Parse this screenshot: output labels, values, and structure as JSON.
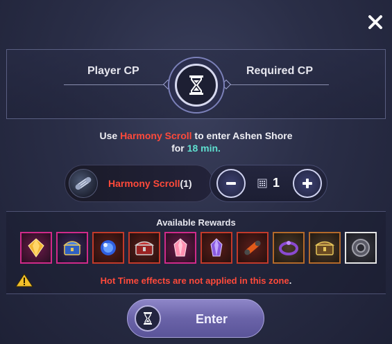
{
  "cp": {
    "player_label": "Player CP",
    "required_label": "Required CP",
    "center_icon": "hourglass-icon"
  },
  "description": {
    "part1": "Use ",
    "item": "Harmony Scroll",
    "part2": " to enter Ashen Shore",
    "part3": "for ",
    "duration": "18 min",
    "part4": "."
  },
  "item": {
    "name": "Harmony Scroll",
    "count": "(1)",
    "icon": "scroll-icon"
  },
  "stepper": {
    "minus": "minus-icon",
    "value": "1",
    "plus": "plus-icon"
  },
  "rewards": {
    "title": "Available Rewards",
    "items": [
      {
        "icon": "golden-gem-icon",
        "border": "#d12a8a"
      },
      {
        "icon": "blue-chest-icon",
        "border": "#d12a8a"
      },
      {
        "icon": "blue-orb-icon",
        "border": "#c33a2a"
      },
      {
        "icon": "red-chest-icon",
        "border": "#c33a2a"
      },
      {
        "icon": "pink-crystal-icon",
        "border": "#d12a8a"
      },
      {
        "icon": "purple-crystal-icon",
        "border": "#c33a2a"
      },
      {
        "icon": "fire-scroll-icon",
        "border": "#c33a2a"
      },
      {
        "icon": "purple-ring-icon",
        "border": "#b46a2a"
      },
      {
        "icon": "golden-chest-icon",
        "border": "#b46a2a"
      },
      {
        "icon": "gear-coin-icon",
        "border": "#e6e6e6"
      }
    ]
  },
  "warning": {
    "text": "Hot Time effects are not applied in this zone",
    "suffix": "."
  },
  "enter": {
    "label": "Enter"
  },
  "colors": {
    "accent_red": "#ff4a3a",
    "accent_teal": "#5fe0d0",
    "button_purple": "#6a63a8"
  }
}
